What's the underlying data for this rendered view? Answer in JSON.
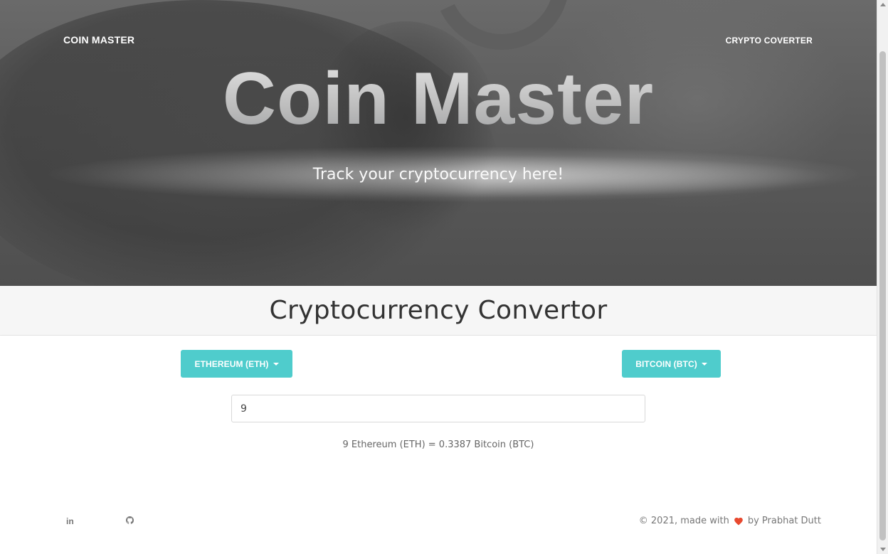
{
  "nav": {
    "brand": "COIN MASTER",
    "link": "CRYPTO COVERTER"
  },
  "hero": {
    "title": "Coin Master",
    "subtitle": "Track your cryptocurrency here!"
  },
  "converter": {
    "title": "Cryptocurrency Convertor",
    "from_currency": "ETHEREUM (ETH)",
    "to_currency": "BITCOIN (BTC)",
    "amount_value": "9",
    "result_text": "9 Ethereum (ETH) = 0.3387 Bitcoin (BTC)"
  },
  "footer": {
    "linkedin_label": "in",
    "github_icon": "github-icon",
    "copyright_prefix": "© 2021, made with",
    "copyright_suffix": "by Prabhat Dutt"
  },
  "colors": {
    "accent": "#4fcccc",
    "heart": "#e8492f"
  }
}
